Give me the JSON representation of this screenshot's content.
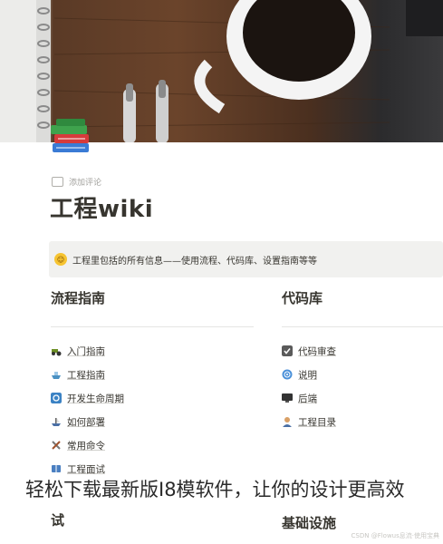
{
  "cover": {
    "image": "coffee-mug-and-pens-on-wooden-desk-photo"
  },
  "page_icon": "books-stack-icon",
  "comment_action_label": "添加评论",
  "page_title": "工程wiki",
  "callout": {
    "emoji": "smiley-face-icon",
    "text": "工程里包括的所有信息——使用流程、代码库、设置指南等等"
  },
  "left_column": {
    "heading": "流程指南",
    "items": [
      {
        "label": "入门指南",
        "icon": "tractor-icon"
      },
      {
        "label": "工程指南",
        "icon": "ship-icon"
      },
      {
        "label": "开发生命周期",
        "icon": "refresh-cycle-icon"
      },
      {
        "label": "如何部署",
        "icon": "boat-icon"
      },
      {
        "label": "常用命令",
        "icon": "tools-icon"
      },
      {
        "label": "工程面试",
        "icon": "book-icon"
      }
    ]
  },
  "right_column": {
    "heading": "代码库",
    "items": [
      {
        "label": "代码审查",
        "icon": "checkbox-icon"
      },
      {
        "label": "说明",
        "icon": "cyclone-icon"
      },
      {
        "label": "后端",
        "icon": "monitor-icon"
      },
      {
        "label": "工程目录",
        "icon": "person-icon"
      }
    ]
  },
  "bottom_left_heading": "试",
  "bottom_right_heading": "基础设施",
  "overlay_caption": "轻松下载最新版I8模软件，让你的设计更高效",
  "watermark": "CSDN @Flowus息流·使用宝典"
}
